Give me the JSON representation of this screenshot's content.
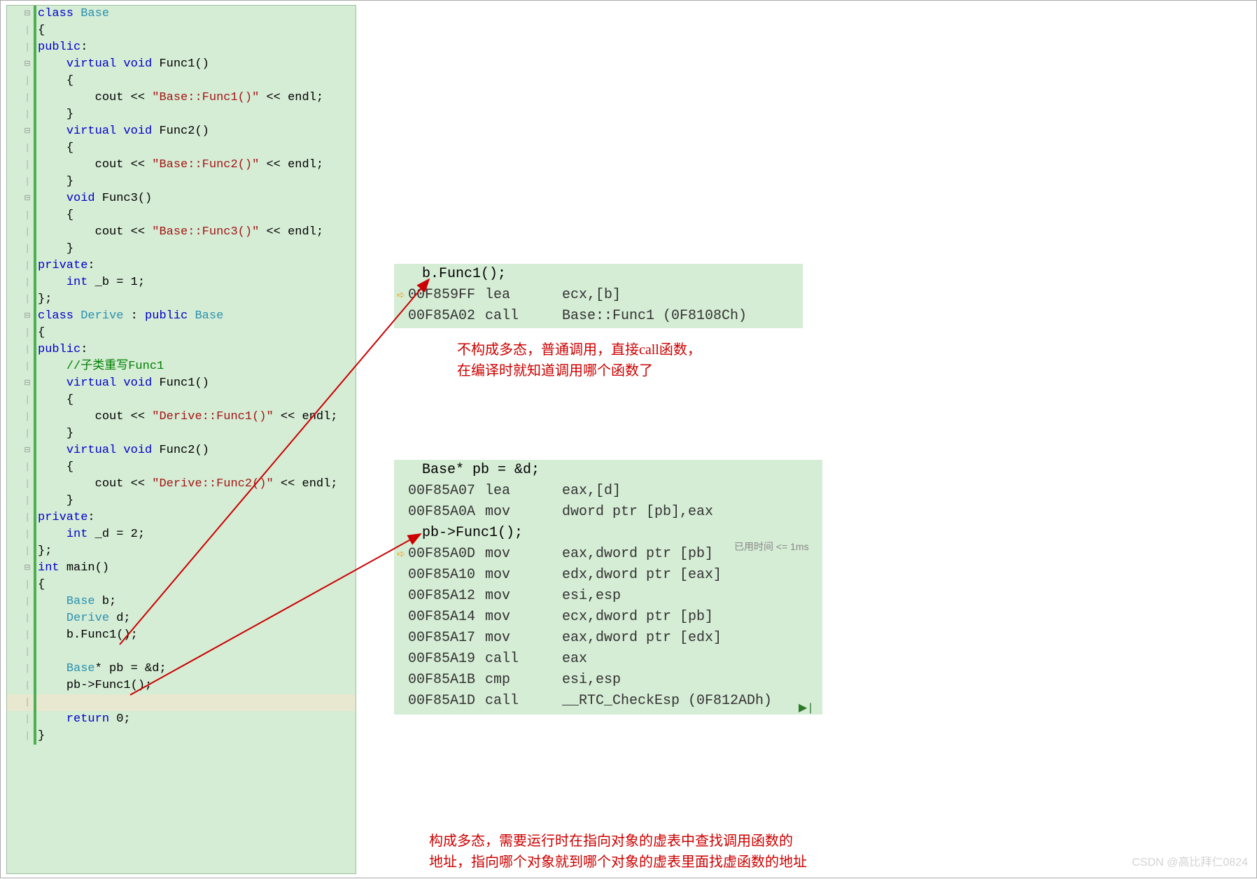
{
  "code": {
    "lines": [
      {
        "fold": "⊟",
        "text": [
          {
            "t": "class ",
            "c": "kw"
          },
          {
            "t": "Base",
            "c": "type"
          }
        ]
      },
      {
        "text": [
          {
            "t": "{"
          }
        ]
      },
      {
        "text": [
          {
            "t": "public",
            "c": "kw"
          },
          {
            "t": ":"
          }
        ]
      },
      {
        "fold": "⊟",
        "indent": 1,
        "text": [
          {
            "t": "virtual void ",
            "c": "kw"
          },
          {
            "t": "Func1()",
            "c": "func"
          }
        ]
      },
      {
        "indent": 1,
        "text": [
          {
            "t": "{"
          }
        ]
      },
      {
        "indent": 2,
        "text": [
          {
            "t": "cout << "
          },
          {
            "t": "\"Base::Func1()\"",
            "c": "str"
          },
          {
            "t": " << endl;"
          }
        ]
      },
      {
        "indent": 1,
        "text": [
          {
            "t": "}"
          }
        ]
      },
      {
        "fold": "⊟",
        "indent": 1,
        "text": [
          {
            "t": "virtual void ",
            "c": "kw"
          },
          {
            "t": "Func2()",
            "c": "func"
          }
        ]
      },
      {
        "indent": 1,
        "text": [
          {
            "t": "{"
          }
        ]
      },
      {
        "indent": 2,
        "text": [
          {
            "t": "cout << "
          },
          {
            "t": "\"Base::Func2()\"",
            "c": "str"
          },
          {
            "t": " << endl;"
          }
        ]
      },
      {
        "indent": 1,
        "text": [
          {
            "t": "}"
          }
        ]
      },
      {
        "fold": "⊟",
        "indent": 1,
        "text": [
          {
            "t": "void ",
            "c": "kw"
          },
          {
            "t": "Func3()",
            "c": "func"
          }
        ]
      },
      {
        "indent": 1,
        "text": [
          {
            "t": "{"
          }
        ]
      },
      {
        "indent": 2,
        "text": [
          {
            "t": "cout << "
          },
          {
            "t": "\"Base::Func3()\"",
            "c": "str"
          },
          {
            "t": " << endl;"
          }
        ]
      },
      {
        "indent": 1,
        "text": [
          {
            "t": "}"
          }
        ]
      },
      {
        "text": [
          {
            "t": "private",
            "c": "kw"
          },
          {
            "t": ":"
          }
        ]
      },
      {
        "indent": 1,
        "text": [
          {
            "t": "int ",
            "c": "kw"
          },
          {
            "t": "_b = 1;"
          }
        ]
      },
      {
        "text": [
          {
            "t": "};"
          }
        ]
      },
      {
        "fold": "⊟",
        "text": [
          {
            "t": "class ",
            "c": "kw"
          },
          {
            "t": "Derive",
            "c": "type"
          },
          {
            "t": " : "
          },
          {
            "t": "public ",
            "c": "kw"
          },
          {
            "t": "Base",
            "c": "type"
          }
        ]
      },
      {
        "text": [
          {
            "t": "{"
          }
        ]
      },
      {
        "text": [
          {
            "t": "public",
            "c": "kw"
          },
          {
            "t": ":"
          }
        ]
      },
      {
        "indent": 1,
        "text": [
          {
            "t": "//子类重写Func1",
            "c": "cmt"
          }
        ]
      },
      {
        "fold": "⊟",
        "indent": 1,
        "text": [
          {
            "t": "virtual void ",
            "c": "kw"
          },
          {
            "t": "Func1()",
            "c": "func"
          }
        ]
      },
      {
        "indent": 1,
        "text": [
          {
            "t": "{"
          }
        ]
      },
      {
        "indent": 2,
        "text": [
          {
            "t": "cout << "
          },
          {
            "t": "\"Derive::Func1()\"",
            "c": "str"
          },
          {
            "t": " << endl;"
          }
        ]
      },
      {
        "indent": 1,
        "text": [
          {
            "t": "}"
          }
        ]
      },
      {
        "fold": "⊟",
        "indent": 1,
        "text": [
          {
            "t": "virtual void ",
            "c": "kw"
          },
          {
            "t": "Func2()",
            "c": "func"
          }
        ]
      },
      {
        "indent": 1,
        "text": [
          {
            "t": "{"
          }
        ]
      },
      {
        "indent": 2,
        "text": [
          {
            "t": "cout << "
          },
          {
            "t": "\"Derive::Func2()\"",
            "c": "str"
          },
          {
            "t": " << endl;"
          }
        ]
      },
      {
        "indent": 1,
        "text": [
          {
            "t": "}"
          }
        ]
      },
      {
        "text": [
          {
            "t": "private",
            "c": "kw"
          },
          {
            "t": ":"
          }
        ]
      },
      {
        "indent": 1,
        "text": [
          {
            "t": "int ",
            "c": "kw"
          },
          {
            "t": "_d = 2;"
          }
        ]
      },
      {
        "text": [
          {
            "t": "};"
          }
        ]
      },
      {
        "fold": "⊟",
        "text": [
          {
            "t": "int ",
            "c": "kw"
          },
          {
            "t": "main()",
            "c": "func"
          }
        ]
      },
      {
        "text": [
          {
            "t": "{"
          }
        ]
      },
      {
        "indent": 1,
        "text": [
          {
            "t": "Base ",
            "c": "type"
          },
          {
            "t": "b;"
          }
        ]
      },
      {
        "indent": 1,
        "text": [
          {
            "t": "Derive ",
            "c": "type"
          },
          {
            "t": "d;"
          }
        ]
      },
      {
        "indent": 1,
        "text": [
          {
            "t": "b.Func1();"
          }
        ]
      },
      {
        "text": [
          {
            "t": ""
          }
        ]
      },
      {
        "indent": 1,
        "text": [
          {
            "t": "Base",
            "c": "type"
          },
          {
            "t": "* pb = &d;"
          }
        ]
      },
      {
        "indent": 1,
        "text": [
          {
            "t": "pb->Func1();"
          }
        ]
      },
      {
        "highlight": true,
        "text": [
          {
            "t": ""
          }
        ]
      },
      {
        "indent": 1,
        "text": [
          {
            "t": "return ",
            "c": "kw"
          },
          {
            "t": "0;"
          }
        ]
      },
      {
        "text": [
          {
            "t": "}"
          }
        ]
      }
    ]
  },
  "asm1": {
    "lines": [
      {
        "src": "    b.Func1();"
      },
      {
        "cursor": true,
        "addr": "00F859FF",
        "op": "lea",
        "args": "ecx,[b]"
      },
      {
        "addr": "00F85A02",
        "op": "call",
        "args": "Base::Func1 (0F8108Ch)"
      }
    ]
  },
  "asm2": {
    "lines": [
      {
        "src": "    Base* pb = &d;"
      },
      {
        "addr": "00F85A07",
        "op": "lea",
        "args": "eax,[d]"
      },
      {
        "addr": "00F85A0A",
        "op": "mov",
        "args": "dword ptr [pb],eax"
      },
      {
        "src": "    pb->Func1();"
      },
      {
        "cursor": true,
        "addr": "00F85A0D",
        "op": "mov",
        "args": "eax,dword ptr [pb]"
      },
      {
        "addr": "00F85A10",
        "op": "mov",
        "args": "edx,dword ptr [eax]"
      },
      {
        "addr": "00F85A12",
        "op": "mov",
        "args": "esi,esp"
      },
      {
        "addr": "00F85A14",
        "op": "mov",
        "args": "ecx,dword ptr [pb]"
      },
      {
        "addr": "00F85A17",
        "op": "mov",
        "args": "eax,dword ptr [edx]"
      },
      {
        "addr": "00F85A19",
        "op": "call",
        "args": "eax"
      },
      {
        "addr": "00F85A1B",
        "op": "cmp",
        "args": "esi,esp"
      },
      {
        "addr": "00F85A1D",
        "op": "call",
        "args": "__RTC_CheckEsp (0F812ADh)"
      }
    ]
  },
  "annotations": {
    "a1_line1": "不构成多态，普通调用，直接call函数，",
    "a1_line2": "在编译时就知道调用哪个函数了",
    "a2_line1": "构成多态，需要运行时在指向对象的虚表中查找调用函数的",
    "a2_line2": "地址，指向哪个对象就到哪个对象的虚表里面找虚函数的地址"
  },
  "timing": "已用时间 <= 1ms",
  "watermark": "CSDN @高比拜仁0824"
}
